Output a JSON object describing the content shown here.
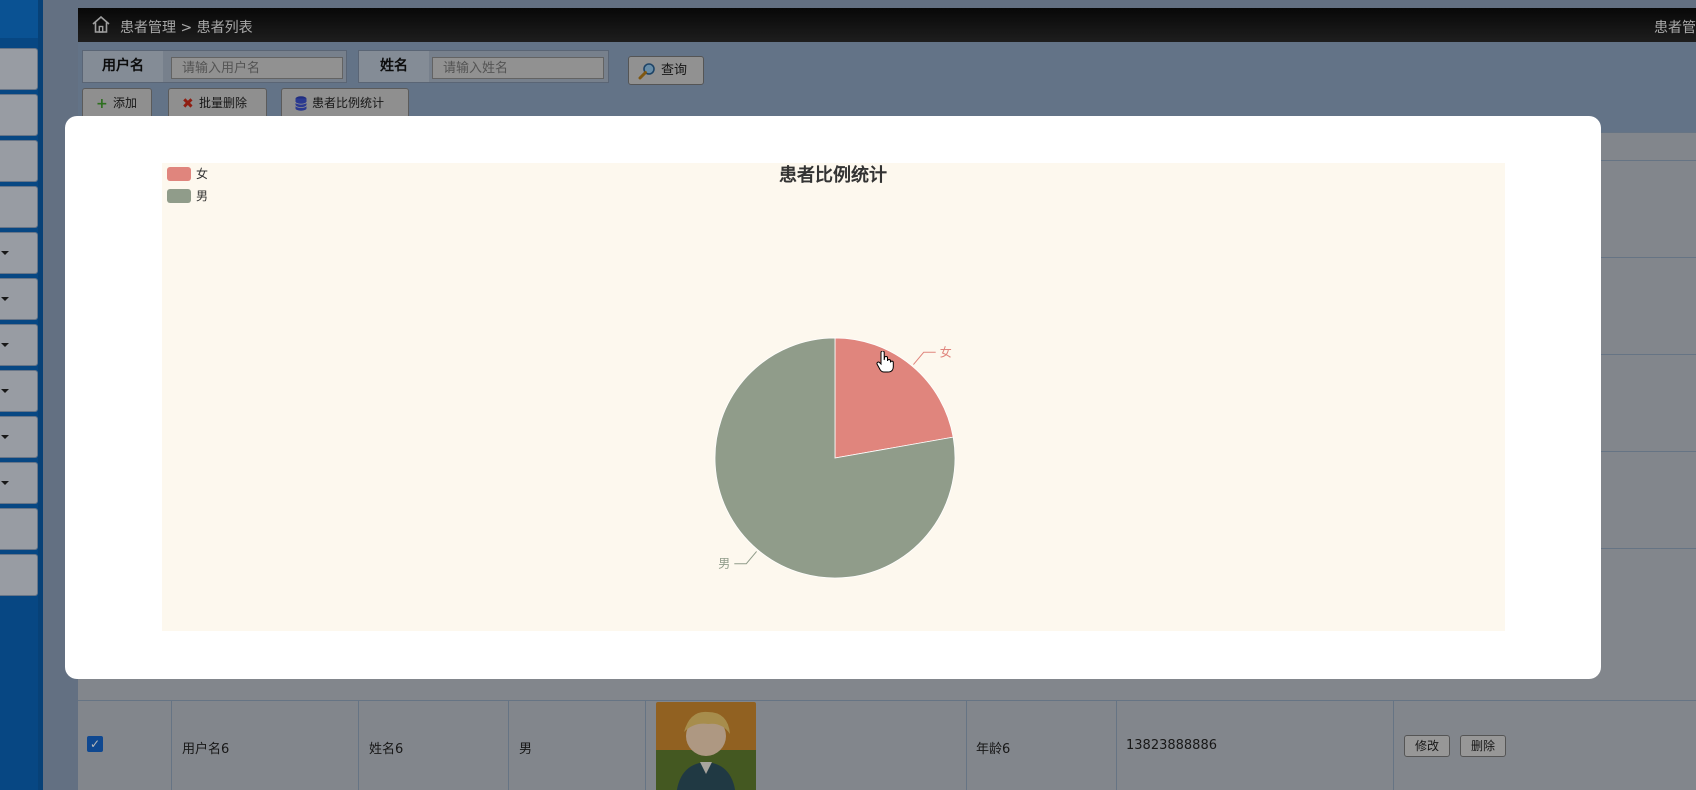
{
  "breadcrumb": {
    "section": "患者管理",
    "separator": ">",
    "page": "患者列表"
  },
  "header_right_title": "患者管",
  "search": {
    "username_label": "用户名",
    "username_placeholder": "请输入用户名",
    "name_label": "姓名",
    "name_placeholder": "请输入姓名",
    "query_button": "查询"
  },
  "toolbar": {
    "add_label": "添加",
    "batch_delete_label": "批量删除",
    "stats_label": "患者比例统计"
  },
  "table": {
    "visible_row": {
      "checked": true,
      "username": "用户名6",
      "name": "姓名6",
      "gender": "男",
      "age": "年龄6",
      "phone": "13823888886",
      "edit_label": "修改",
      "delete_label": "删除"
    }
  },
  "chart_data": {
    "type": "pie",
    "title": "患者比例统计",
    "legend_position": "top-left",
    "categories": [
      "女",
      "男"
    ],
    "values": [
      1,
      3.5
    ],
    "colors": [
      "#e0857d",
      "#909c8a"
    ],
    "background": "#fdf8ee"
  },
  "icons": {
    "home": "home-icon",
    "search": "magnifier-icon",
    "add": "plus-icon",
    "batch_delete": "x-icon",
    "stats": "database-icon",
    "cursor": "hand-cursor-icon"
  }
}
